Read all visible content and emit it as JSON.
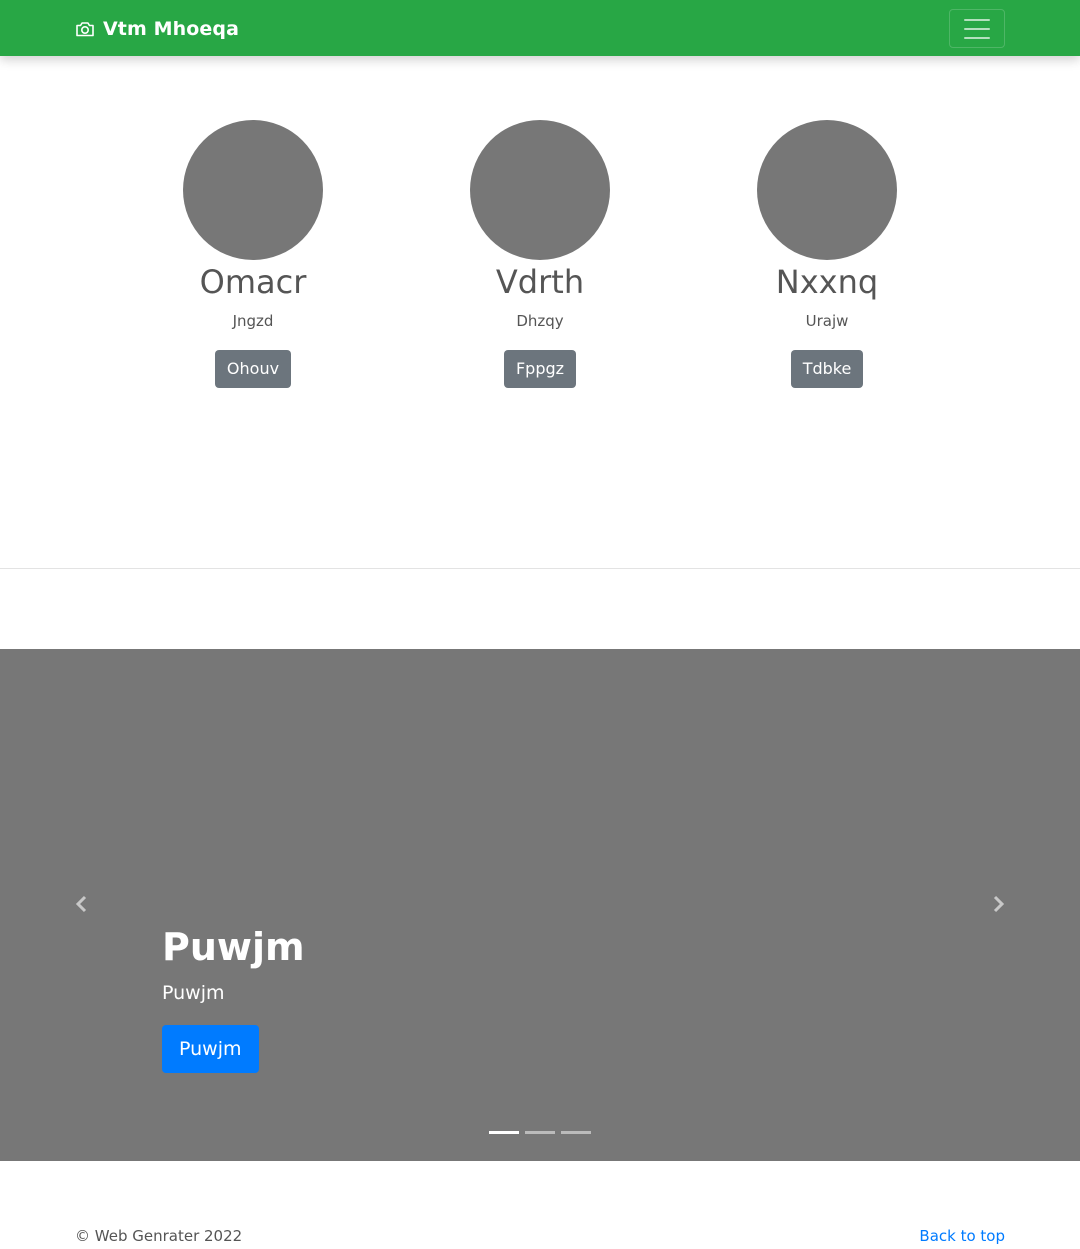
{
  "navbar": {
    "brand": "Vtm Mhoeqa",
    "brand_icon": "camera-icon",
    "menu_icon": "hamburger-icon",
    "background_color": "#28a745"
  },
  "features": [
    {
      "title": "Omacr",
      "subtitle": "Jngzd",
      "button": "Ohouv"
    },
    {
      "title": "Vdrth",
      "subtitle": "Dhzqy",
      "button": "Fppgz"
    },
    {
      "title": "Nxxnq",
      "subtitle": "Urajw",
      "button": "Tdbke"
    }
  ],
  "carousel": {
    "heading": "Puwjm",
    "text": "Puwjm",
    "button": "Puwjm",
    "slide_count": 3,
    "active_index": 0,
    "prev_icon": "chevron-left-icon",
    "next_icon": "chevron-right-icon",
    "button_color": "#007bff"
  },
  "footer": {
    "copyright": "© Web Genrater 2022",
    "back_to_top": "Back to top"
  }
}
